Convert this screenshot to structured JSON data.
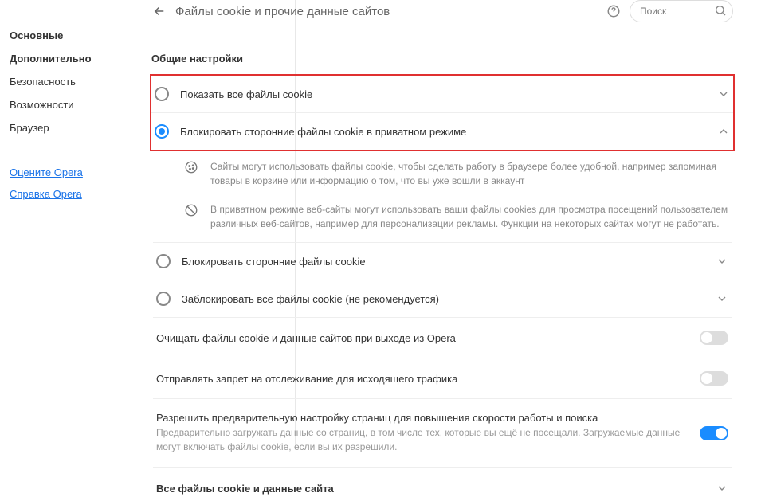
{
  "sidebar": {
    "items": [
      {
        "label": "Основные",
        "bold": true
      },
      {
        "label": "Дополнительно",
        "bold": true
      },
      {
        "label": "Безопасность",
        "bold": false
      },
      {
        "label": "Возможности",
        "bold": false
      },
      {
        "label": "Браузер",
        "bold": false
      }
    ],
    "links": [
      {
        "label": "Оцените Opera"
      },
      {
        "label": "Справка Opera"
      }
    ]
  },
  "header": {
    "title": "Файлы cookie и прочие данные сайтов"
  },
  "search": {
    "placeholder": "Поиск"
  },
  "section": {
    "title": "Общие настройки"
  },
  "radios": {
    "r1": {
      "label": "Показать все файлы cookie",
      "selected": false,
      "expanded": false
    },
    "r2": {
      "label": "Блокировать сторонние файлы cookie в приватном режиме",
      "selected": true,
      "expanded": true,
      "desc1": "Сайты могут использовать файлы cookie, чтобы сделать работу в браузере более удобной, например запоминая товары в корзине или информацию о том, что вы уже вошли в аккаунт",
      "desc2": "В приватном режиме веб-сайты могут использовать ваши файлы cookies для просмотра посещений пользователем различных веб-сайтов, например для персонализации рекламы. Функции на некоторых сайтах могут не работать."
    },
    "r3": {
      "label": "Блокировать сторонние файлы cookie",
      "selected": false,
      "expanded": false
    },
    "r4": {
      "label": "Заблокировать все файлы cookie (не рекомендуется)",
      "selected": false,
      "expanded": false
    }
  },
  "toggles": {
    "t1": {
      "label": "Очищать файлы cookie и данные сайтов при выходе из Opera",
      "on": false
    },
    "t2": {
      "label": "Отправлять запрет на отслеживание для исходящего трафика",
      "on": false
    },
    "t3": {
      "label": "Разрешить предварительную настройку страниц для повышения скорости работы и поиска",
      "sub": "Предварительно загружать данные со страниц, в том числе тех, которые вы ещё не посещали. Загружаемые данные могут включать файлы cookie, если вы их разрешили.",
      "on": true
    }
  },
  "final": {
    "label": "Все файлы cookie и данные сайта"
  }
}
